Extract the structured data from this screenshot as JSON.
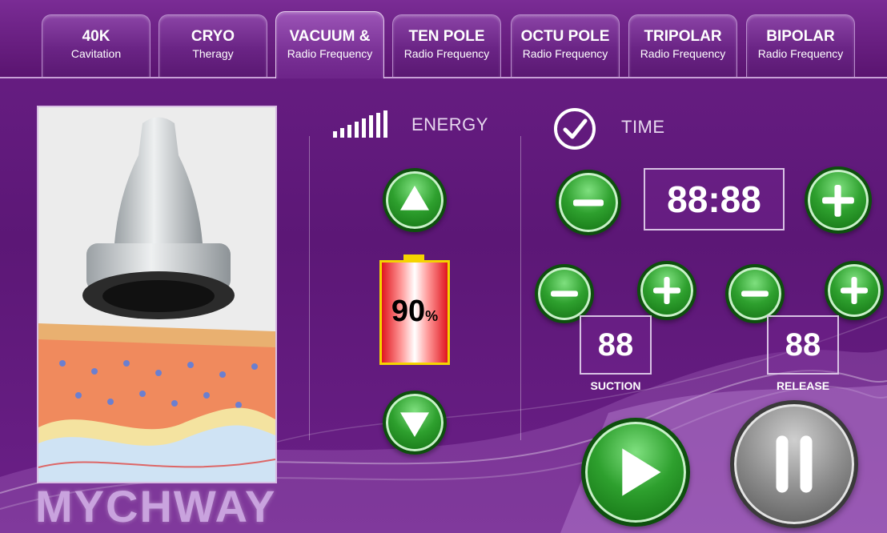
{
  "tabs": [
    {
      "title": "40K",
      "subtitle": "Cavitation"
    },
    {
      "title": "CRYO",
      "subtitle": "Theragy"
    },
    {
      "title": "VACUUM &",
      "subtitle": "Radio Frequency"
    },
    {
      "title": "TEN POLE",
      "subtitle": "Radio Frequency"
    },
    {
      "title": "OCTU POLE",
      "subtitle": "Radio Frequency"
    },
    {
      "title": "TRIPOLAR",
      "subtitle": "Radio Frequency"
    },
    {
      "title": "BIPOLAR",
      "subtitle": "Radio Frequency"
    }
  ],
  "energy": {
    "label": "ENERGY",
    "level_value": "90",
    "level_unit": "%",
    "level_fraction": 0.9
  },
  "time": {
    "label": "TIME",
    "value": "88:88"
  },
  "suction": {
    "value": "88",
    "label": "SUCTION"
  },
  "release": {
    "value": "88",
    "label": "RELEASE"
  },
  "brand": "MYCHWAY",
  "colors": {
    "accent_green": "#2ea02e",
    "background_purple": "#5c1776",
    "battery_red": "#e0161f"
  }
}
